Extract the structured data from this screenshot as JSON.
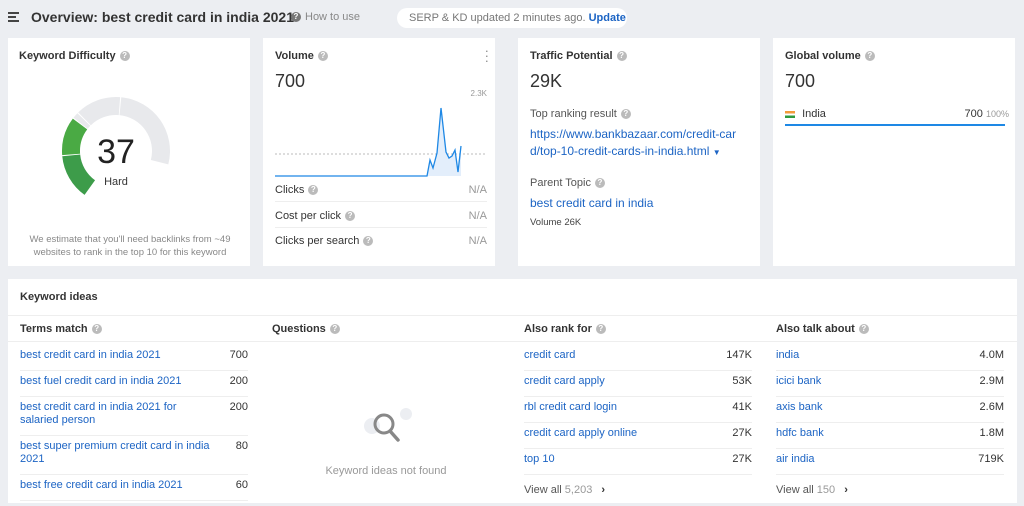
{
  "header": {
    "menu_icon": "hamburger-icon",
    "title": "Overview: best credit card in india 2021",
    "how_to_use": "How to use",
    "status": "SERP & KD updated 2 minutes ago.",
    "update": "Update"
  },
  "kd": {
    "title": "Keyword Difficulty",
    "value": "37",
    "label": "Hard",
    "score": 37,
    "note": "We estimate that you'll need backlinks from ~49 websites to rank in the top 10 for this keyword"
  },
  "volume": {
    "title": "Volume",
    "value": "700",
    "chart_max_label": "2.3K",
    "metrics": [
      {
        "label": "Clicks",
        "value": "N/A"
      },
      {
        "label": "Cost per click",
        "value": "N/A"
      },
      {
        "label": "Clicks per search",
        "value": "N/A"
      }
    ]
  },
  "traffic": {
    "title": "Traffic Potential",
    "value": "29K",
    "top_label": "Top ranking result",
    "top_url_line1": "https://www.bankbazaar.com/credit-car",
    "top_url_line2": "d/top-10-credit-cards-in-india.html",
    "parent_label": "Parent Topic",
    "parent_link": "best credit card in india",
    "parent_volume": "Volume 26K"
  },
  "global": {
    "title": "Global volume",
    "value": "700",
    "country": "India",
    "country_value": "700",
    "country_pct": "100%",
    "share": 100
  },
  "ideas": {
    "title": "Keyword ideas",
    "columns": [
      {
        "title": "Terms match",
        "items": [
          {
            "k": "best credit card in india 2021",
            "v": "700"
          },
          {
            "k": "best fuel credit card in india 2021",
            "v": "200"
          },
          {
            "k": "best credit card in india 2021 for salaried person",
            "v": "200"
          },
          {
            "k": "best super premium credit card in india 2021",
            "v": "80"
          },
          {
            "k": "best free credit card in india 2021",
            "v": "60"
          }
        ]
      },
      {
        "title": "Questions",
        "empty": "Keyword ideas not found"
      },
      {
        "title": "Also rank for",
        "items": [
          {
            "k": "credit card",
            "v": "147K"
          },
          {
            "k": "credit card apply",
            "v": "53K"
          },
          {
            "k": "rbl credit card login",
            "v": "41K"
          },
          {
            "k": "credit card apply online",
            "v": "27K"
          },
          {
            "k": "top 10",
            "v": "27K"
          }
        ],
        "view_all": "View all",
        "count": "5,203"
      },
      {
        "title": "Also talk about",
        "items": [
          {
            "k": "india",
            "v": "4.0M"
          },
          {
            "k": "icici bank",
            "v": "2.9M"
          },
          {
            "k": "axis bank",
            "v": "2.6M"
          },
          {
            "k": "hdfc bank",
            "v": "1.8M"
          },
          {
            "k": "air india",
            "v": "719K"
          }
        ],
        "view_all": "View all",
        "count": "150"
      }
    ]
  },
  "colors": {
    "link": "#1c64c4",
    "accent": "#1e88e5",
    "gauge_green": "#45a845",
    "gauge_lime": "#a8c43a",
    "gauge_empty": "#e8e9ec"
  }
}
